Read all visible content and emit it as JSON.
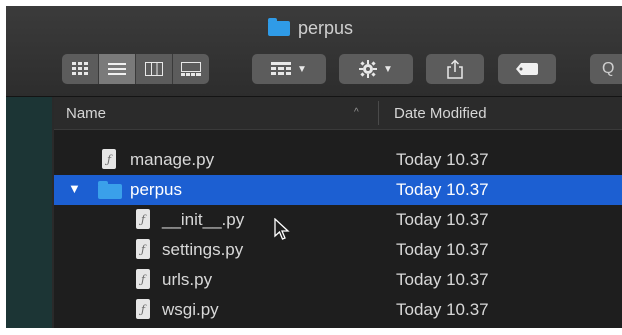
{
  "window": {
    "title": "perpus",
    "title_icon": "folder-icon"
  },
  "toolbar": {
    "view_modes": [
      {
        "name": "icon-view",
        "icon": "grid-icon",
        "active": false
      },
      {
        "name": "list-view",
        "icon": "list-icon",
        "active": true
      },
      {
        "name": "column-view",
        "icon": "columns-icon",
        "active": false
      },
      {
        "name": "gallery-view",
        "icon": "gallery-icon",
        "active": false
      }
    ],
    "group_icon": "group-grid-icon",
    "action_icon": "gear-icon",
    "share_icon": "share-icon",
    "tag_icon": "tag-icon",
    "search_partial": "Q"
  },
  "columns": {
    "name": "Name",
    "date_modified": "Date Modified",
    "sort_indicator": "^"
  },
  "rows": [
    {
      "name": "manage.py",
      "date": "Today 10.37",
      "kind": "python-file",
      "selected": false,
      "indent": 1
    },
    {
      "name": "perpus",
      "date": "Today 10.37",
      "kind": "folder",
      "selected": true,
      "expanded": true,
      "indent": 0,
      "disclosure": "▼"
    },
    {
      "name": "__init__.py",
      "date": "Today 10.37",
      "kind": "python-file",
      "selected": false,
      "indent": 2
    },
    {
      "name": "settings.py",
      "date": "Today 10.37",
      "kind": "python-file",
      "selected": false,
      "indent": 2
    },
    {
      "name": "urls.py",
      "date": "Today 10.37",
      "kind": "python-file",
      "selected": false,
      "indent": 2
    },
    {
      "name": "wsgi.py",
      "date": "Today 10.37",
      "kind": "python-file",
      "selected": false,
      "indent": 2
    }
  ],
  "colors": {
    "selection": "#1c5fd2",
    "folder": "#3aa0ea",
    "sidebar": "#1c3535"
  }
}
